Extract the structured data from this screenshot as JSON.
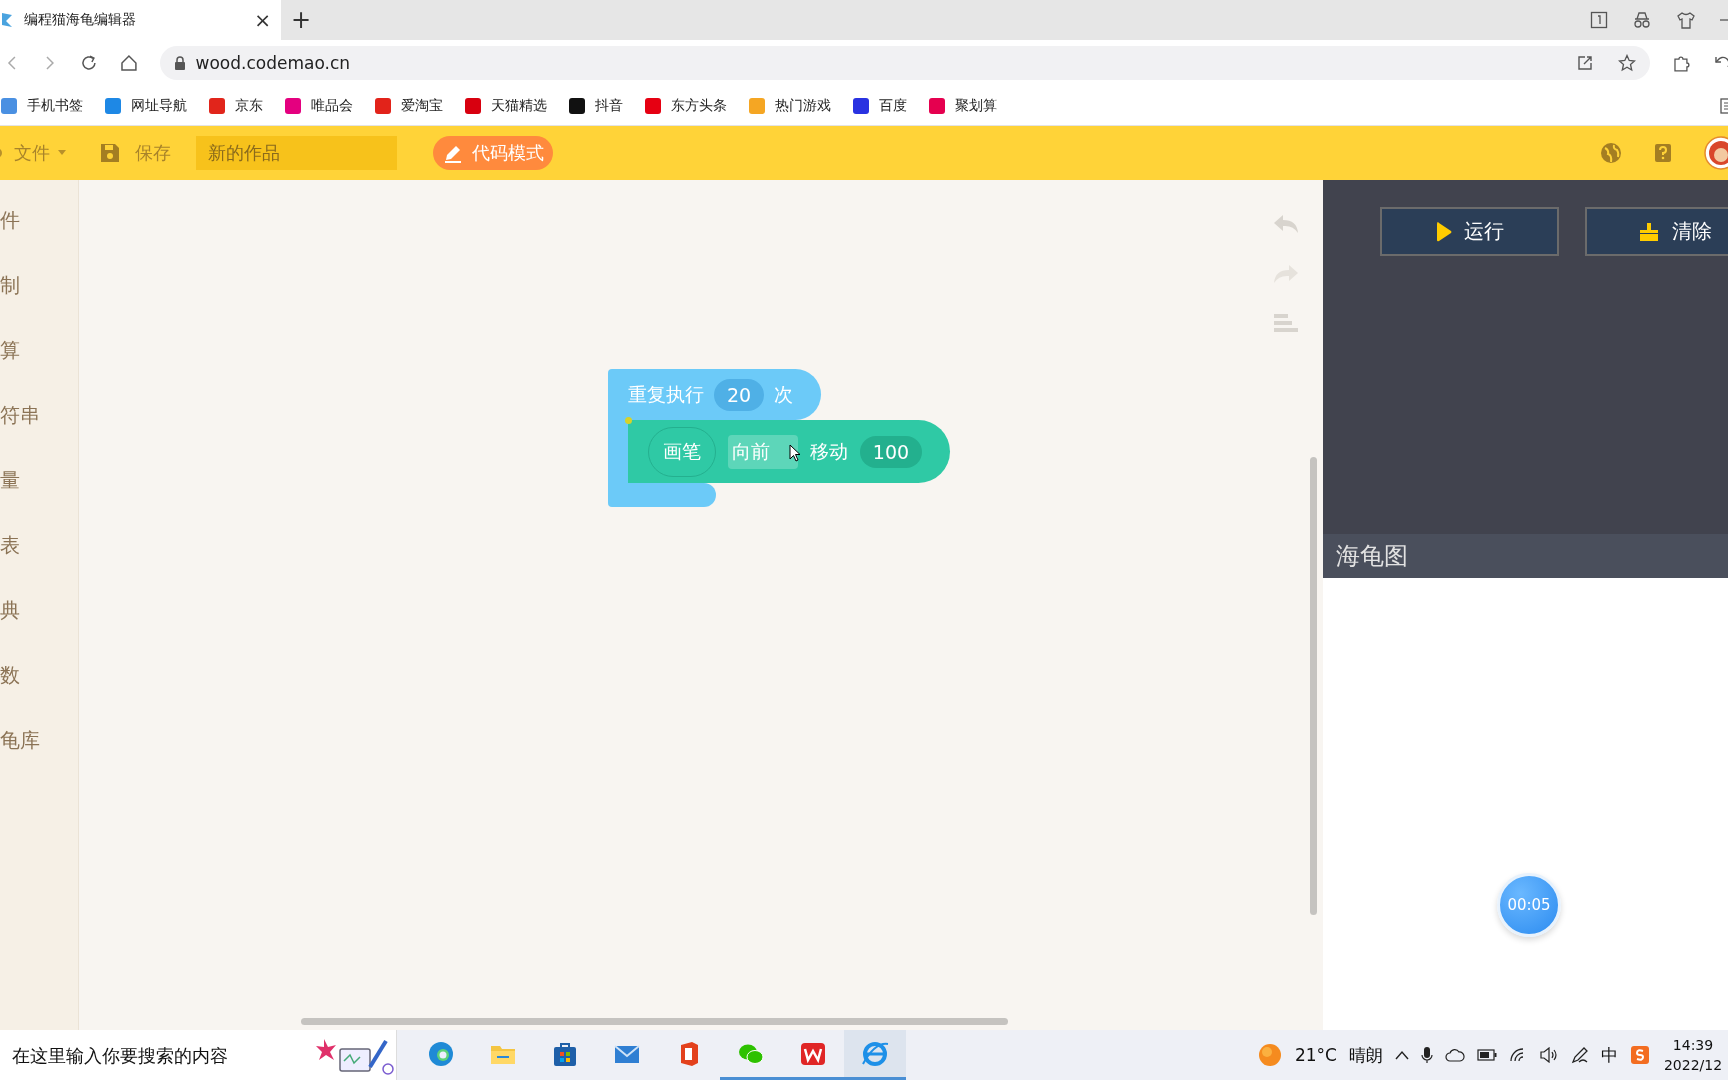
{
  "browser": {
    "tab": {
      "title": "编程猫海龟编辑器",
      "close": "×",
      "new_tab": "+"
    },
    "url": "wood.codemao.cn",
    "bookmarks": [
      {
        "label": "手机书签",
        "color": "#4a90e2"
      },
      {
        "label": "网址导航",
        "color": "#1e88e5"
      },
      {
        "label": "京东",
        "color": "#e1251b"
      },
      {
        "label": "唯品会",
        "color": "#e4007f"
      },
      {
        "label": "爱淘宝",
        "color": "#e2231a"
      },
      {
        "label": "天猫精选",
        "color": "#d8000f"
      },
      {
        "label": "抖音",
        "color": "#111111"
      },
      {
        "label": "东方头条",
        "color": "#e60012"
      },
      {
        "label": "热门游戏",
        "color": "#f5a623"
      },
      {
        "label": "百度",
        "color": "#2932e1"
      },
      {
        "label": "聚划算",
        "color": "#e5004f"
      }
    ]
  },
  "toolbar": {
    "file_menu": "文件",
    "save": "保存",
    "title_field": {
      "value": "新的作品"
    },
    "mode_button": "代码模式"
  },
  "sidebar": {
    "items": [
      "件",
      "制",
      "算",
      "符串",
      "量",
      "表",
      "典",
      "数",
      "龟库"
    ]
  },
  "workspace": {
    "blocks": [
      {
        "kind": "repeat",
        "label": "重复执行",
        "count": "20",
        "suffix": "次",
        "children": [
          {
            "kind": "move",
            "pen": "画笔",
            "direction": "向前",
            "action": "移动",
            "distance": "100"
          }
        ]
      }
    ]
  },
  "stage": {
    "buttons": [
      {
        "kind": "run",
        "label": "运行"
      },
      {
        "kind": "clear",
        "label": "清除"
      }
    ],
    "title": "海龟图",
    "timer": "00:05"
  },
  "taskbar": {
    "search": {
      "placeholder": "在这里输入你要搜索的内容"
    },
    "apps": [
      {
        "kind": "edge",
        "running": false
      },
      {
        "kind": "folder",
        "running": false
      },
      {
        "kind": "store",
        "running": false
      },
      {
        "kind": "mail",
        "running": false
      },
      {
        "kind": "office",
        "running": false
      },
      {
        "kind": "wechat",
        "running": true
      },
      {
        "kind": "wps",
        "running": true
      },
      {
        "kind": "ie",
        "running": true
      }
    ],
    "temperature": "21°C",
    "weather": "晴朗",
    "ime": "中",
    "time": "14:39",
    "date": "2022/12"
  }
}
